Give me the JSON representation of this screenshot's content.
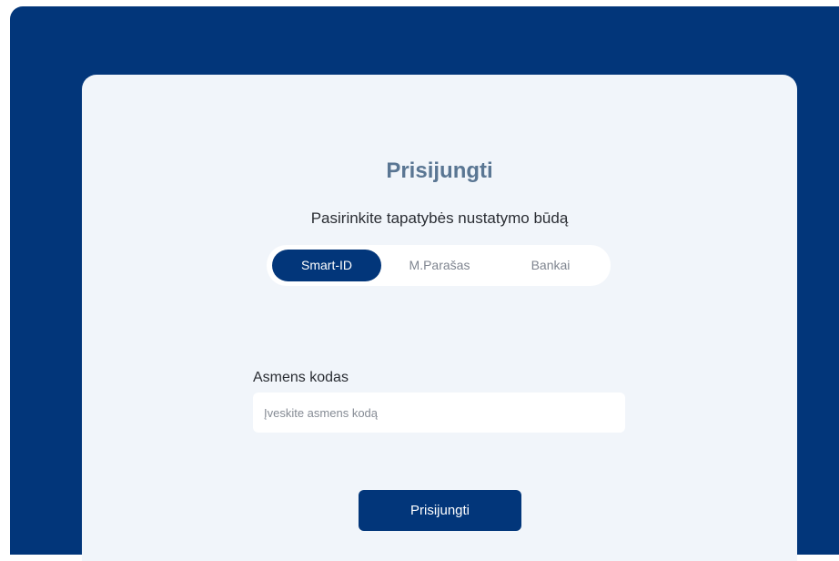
{
  "login": {
    "title": "Prisijungti",
    "subtitle": "Pasirinkite tapatybės nustatymo būdą",
    "methods": [
      {
        "label": "Smart-ID",
        "active": true
      },
      {
        "label": "M.Parašas",
        "active": false
      },
      {
        "label": "Bankai",
        "active": false
      }
    ],
    "id_field": {
      "label": "Asmens kodas",
      "placeholder": "Įveskite asmens kodą",
      "value": ""
    },
    "submit_label": "Prisijungti"
  },
  "colors": {
    "brand": "#02367a",
    "card_background": "#f1f5fa",
    "title": "#5a7693"
  }
}
